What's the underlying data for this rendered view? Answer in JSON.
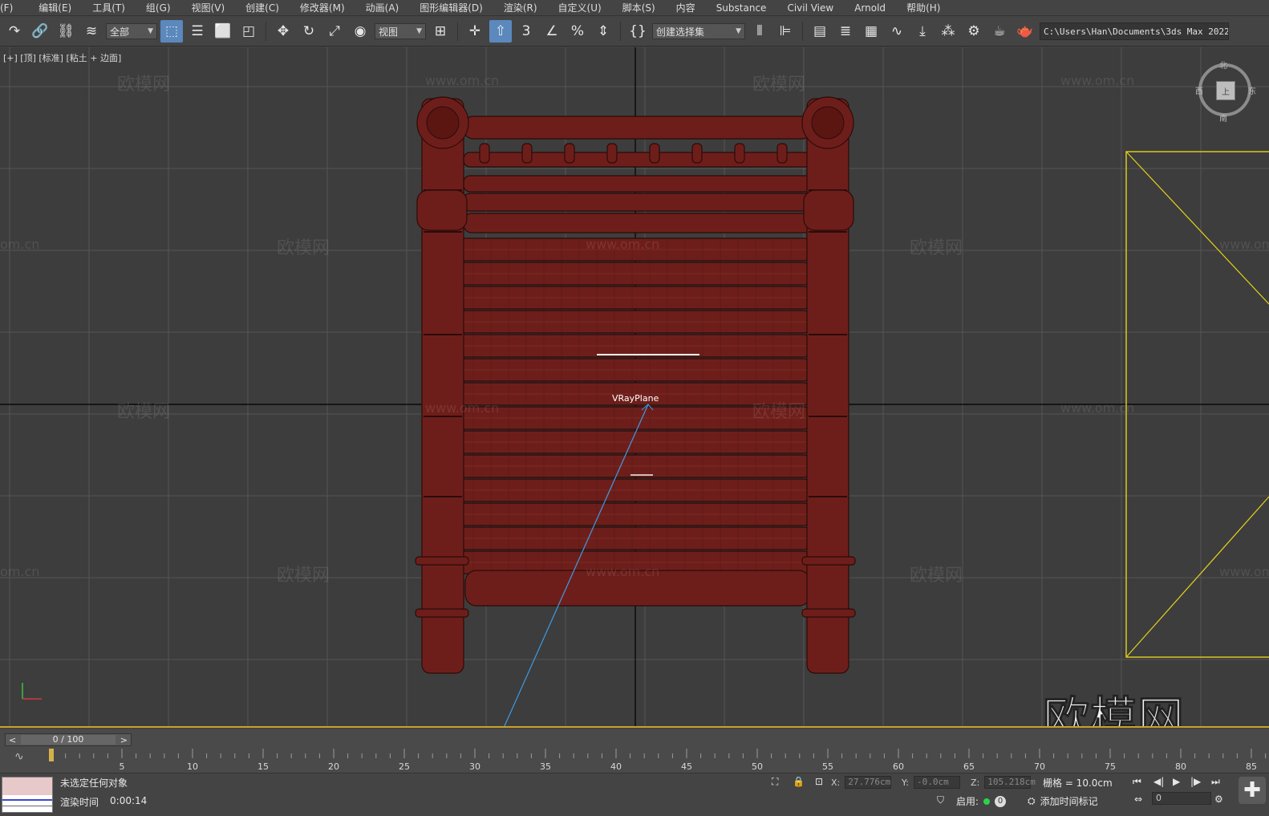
{
  "menu": [
    "(F)",
    "编辑(E)",
    "工具(T)",
    "组(G)",
    "视图(V)",
    "创建(C)",
    "修改器(M)",
    "动画(A)",
    "图形编辑器(D)",
    "渲染(R)",
    "自定义(U)",
    "脚本(S)",
    "内容",
    "Substance",
    "Civil View",
    "Arnold",
    "帮助(H)"
  ],
  "toolbar": {
    "selection_filter": "全部",
    "reference_coord": "视图",
    "named_selection": "创建选择集",
    "snap_value": "3",
    "project_path": "C:\\Users\\Han\\Documents\\3ds Max 2022"
  },
  "viewport": {
    "label": "[+] [顶] [标准] [粘土 + 边面]",
    "object_label": "VRayPlane",
    "watermark_text": "欧模网",
    "watermark_url": "www.om.cn",
    "watermark_url_partial": "om.cn",
    "brand_mark": "欧模网",
    "viewcube": {
      "face": "上",
      "north": "北",
      "south": "南",
      "east": "东",
      "west": "西"
    }
  },
  "trackbar": {
    "slider": "0 / 100",
    "prev": "<",
    "next": ">",
    "ticks": [
      "5",
      "10",
      "15",
      "20",
      "25",
      "30",
      "35",
      "40",
      "45",
      "50",
      "55",
      "60",
      "65",
      "70",
      "75",
      "80",
      "85"
    ]
  },
  "status": {
    "selection": "未选定任何对象",
    "render_label": "渲染时间",
    "render_value": "0:00:14",
    "x_label": "X:",
    "x_value": "27.776cm",
    "y_label": "Y:",
    "y_value": "-0.0cm",
    "z_label": "Z:",
    "z_value": "105.218cm",
    "grid": "栅格 = 10.0cm",
    "enable": "启用:",
    "enable_count": "0",
    "add_time_tag": "添加时间标记",
    "frame": "0"
  },
  "colors": {
    "model": "#6e1e1a",
    "model_edge": "#2a0c0a",
    "selection_box": "#e5d21a",
    "grid": "#555555",
    "axis": "#000000",
    "camera_line": "#3d9be6"
  }
}
